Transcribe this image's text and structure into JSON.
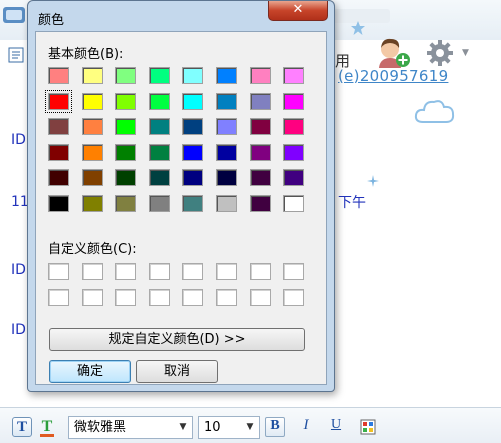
{
  "background": {
    "id_label": "ID",
    "time_number": "11",
    "partial_label": "用",
    "partial_link": "(e)200957619",
    "afternoon_label": "下午"
  },
  "dialog": {
    "title": "颜色",
    "close_glyph": "✕",
    "basic_label": "基本颜色(B):",
    "custom_label": "自定义颜色(C):",
    "define_button": "规定自定义颜色(D) >>",
    "ok_button": "确定",
    "cancel_button": "取消",
    "selected_swatch": "#ff0000",
    "basic_colors": [
      [
        "#ff8080",
        "#ffff80",
        "#80ff80",
        "#00ff80",
        "#80ffff",
        "#0080ff",
        "#ff80c0",
        "#ff80ff"
      ],
      [
        "#ff0000",
        "#ffff00",
        "#80ff00",
        "#00ff40",
        "#00ffff",
        "#0080c0",
        "#8080c0",
        "#ff00ff"
      ],
      [
        "#804040",
        "#ff8040",
        "#00ff00",
        "#008080",
        "#004080",
        "#8080ff",
        "#800040",
        "#ff0080"
      ],
      [
        "#800000",
        "#ff8000",
        "#008000",
        "#008040",
        "#0000ff",
        "#0000a0",
        "#800080",
        "#8000ff"
      ],
      [
        "#400000",
        "#804000",
        "#004000",
        "#004040",
        "#000080",
        "#000040",
        "#400040",
        "#400080"
      ],
      [
        "#000000",
        "#808000",
        "#808040",
        "#808080",
        "#408080",
        "#c0c0c0",
        "#400040",
        "#ffffff"
      ]
    ]
  },
  "toolbar": {
    "font_color_glyph": "T",
    "font_style_glyph": "T",
    "font_name": "微软雅黑",
    "font_size": "10",
    "bold": "B",
    "italic": "I",
    "underline": "U",
    "dropdown_glyph": "▼"
  },
  "colors": {
    "dialog_frame": "#c4d8ec",
    "dialog_body": "#f0f0f0",
    "close_button": "#c7442a",
    "link_blue": "#3f86c8",
    "text_blue": "#2233bb"
  }
}
